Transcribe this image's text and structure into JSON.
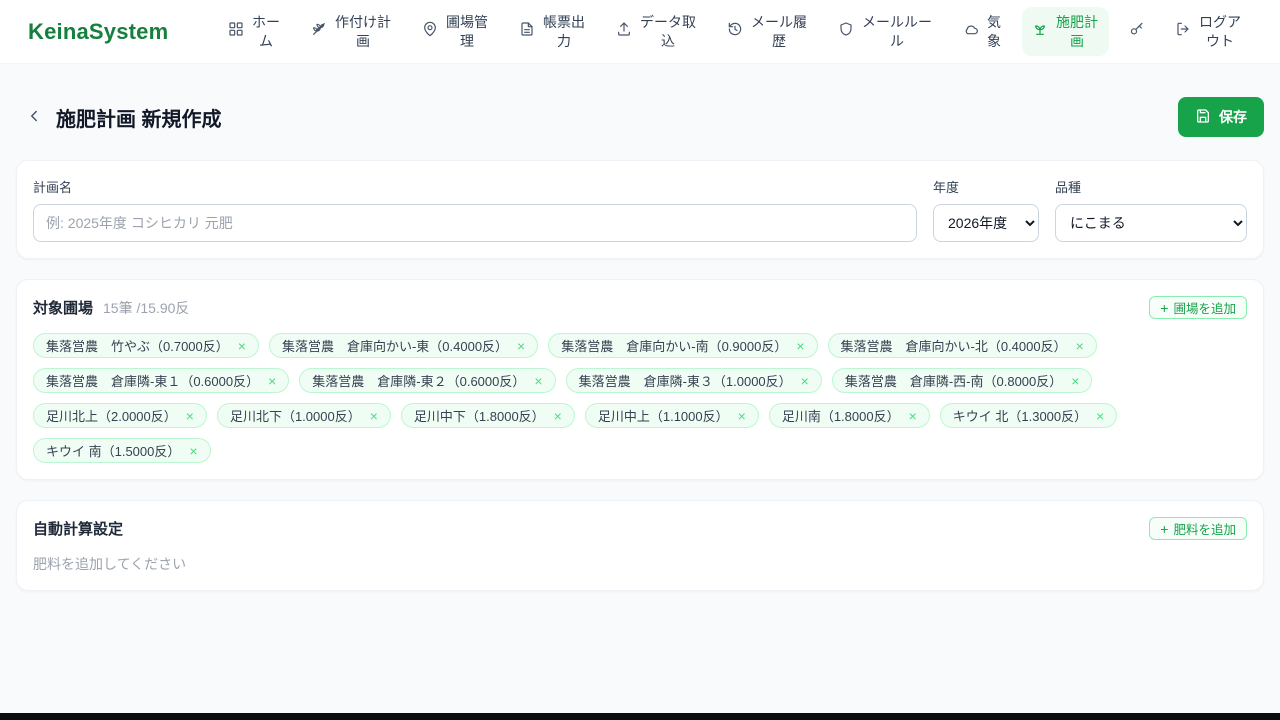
{
  "brand": "KeinaSystem",
  "colors": {
    "brand_green": "#15803d",
    "accent_green": "#16a34a",
    "tag_bg": "#f0fdf4",
    "tag_border": "#bbf7d0"
  },
  "nav": {
    "items": [
      {
        "label": "ホーム",
        "icon": "grid-icon",
        "active": false
      },
      {
        "label": "作付け計画",
        "icon": "wheat-icon",
        "active": false
      },
      {
        "label": "圃場管理",
        "icon": "map-pin-icon",
        "active": false
      },
      {
        "label": "帳票出力",
        "icon": "document-icon",
        "active": false
      },
      {
        "label": "データ取込",
        "icon": "upload-icon",
        "active": false
      },
      {
        "label": "メール履歴",
        "icon": "history-icon",
        "active": false
      },
      {
        "label": "メールルール",
        "icon": "shield-icon",
        "active": false
      },
      {
        "label": "気象",
        "icon": "cloud-icon",
        "active": false
      },
      {
        "label": "施肥計画",
        "icon": "sprout-icon",
        "active": true
      },
      {
        "label": "",
        "icon": "key-icon",
        "active": false
      },
      {
        "label": "ログアウト",
        "icon": "logout-icon",
        "active": false
      }
    ]
  },
  "header": {
    "title": "施肥計画 新規作成",
    "save_label": "保存"
  },
  "form": {
    "plan_name": {
      "label": "計画名",
      "placeholder": "例: 2025年度 コシヒカリ 元肥",
      "value": ""
    },
    "year": {
      "label": "年度",
      "value": "2026年度"
    },
    "variety": {
      "label": "品種",
      "value": "にこまる"
    }
  },
  "fields_section": {
    "title": "対象圃場",
    "count_summary": "15筆 /15.90反",
    "add_button_label": "圃場を追加",
    "plus_glyph": "+",
    "remove_glyph": "×",
    "tags": [
      {
        "name": "集落営農　竹やぶ（0.7000反）"
      },
      {
        "name": "集落営農　倉庫向かい-東（0.4000反）"
      },
      {
        "name": "集落営農　倉庫向かい-南（0.9000反）"
      },
      {
        "name": "集落営農　倉庫向かい-北（0.4000反）"
      },
      {
        "name": "集落営農　倉庫隣-東１（0.6000反）"
      },
      {
        "name": "集落営農　倉庫隣-東２（0.6000反）"
      },
      {
        "name": "集落営農　倉庫隣-東３（1.0000反）"
      },
      {
        "name": "集落営農　倉庫隣-西-南（0.8000反）"
      },
      {
        "name": "足川北上（2.0000反）"
      },
      {
        "name": "足川北下（1.0000反）"
      },
      {
        "name": "足川中下（1.8000反）"
      },
      {
        "name": "足川中上（1.1000反）"
      },
      {
        "name": "足川南（1.8000反）"
      },
      {
        "name": "キウイ 北（1.3000反）"
      },
      {
        "name": "キウイ 南（1.5000反）"
      }
    ]
  },
  "calc_section": {
    "title": "自動計算設定",
    "add_button_label": "肥料を追加",
    "plus_glyph": "+",
    "empty_message": "肥料を追加してください"
  }
}
